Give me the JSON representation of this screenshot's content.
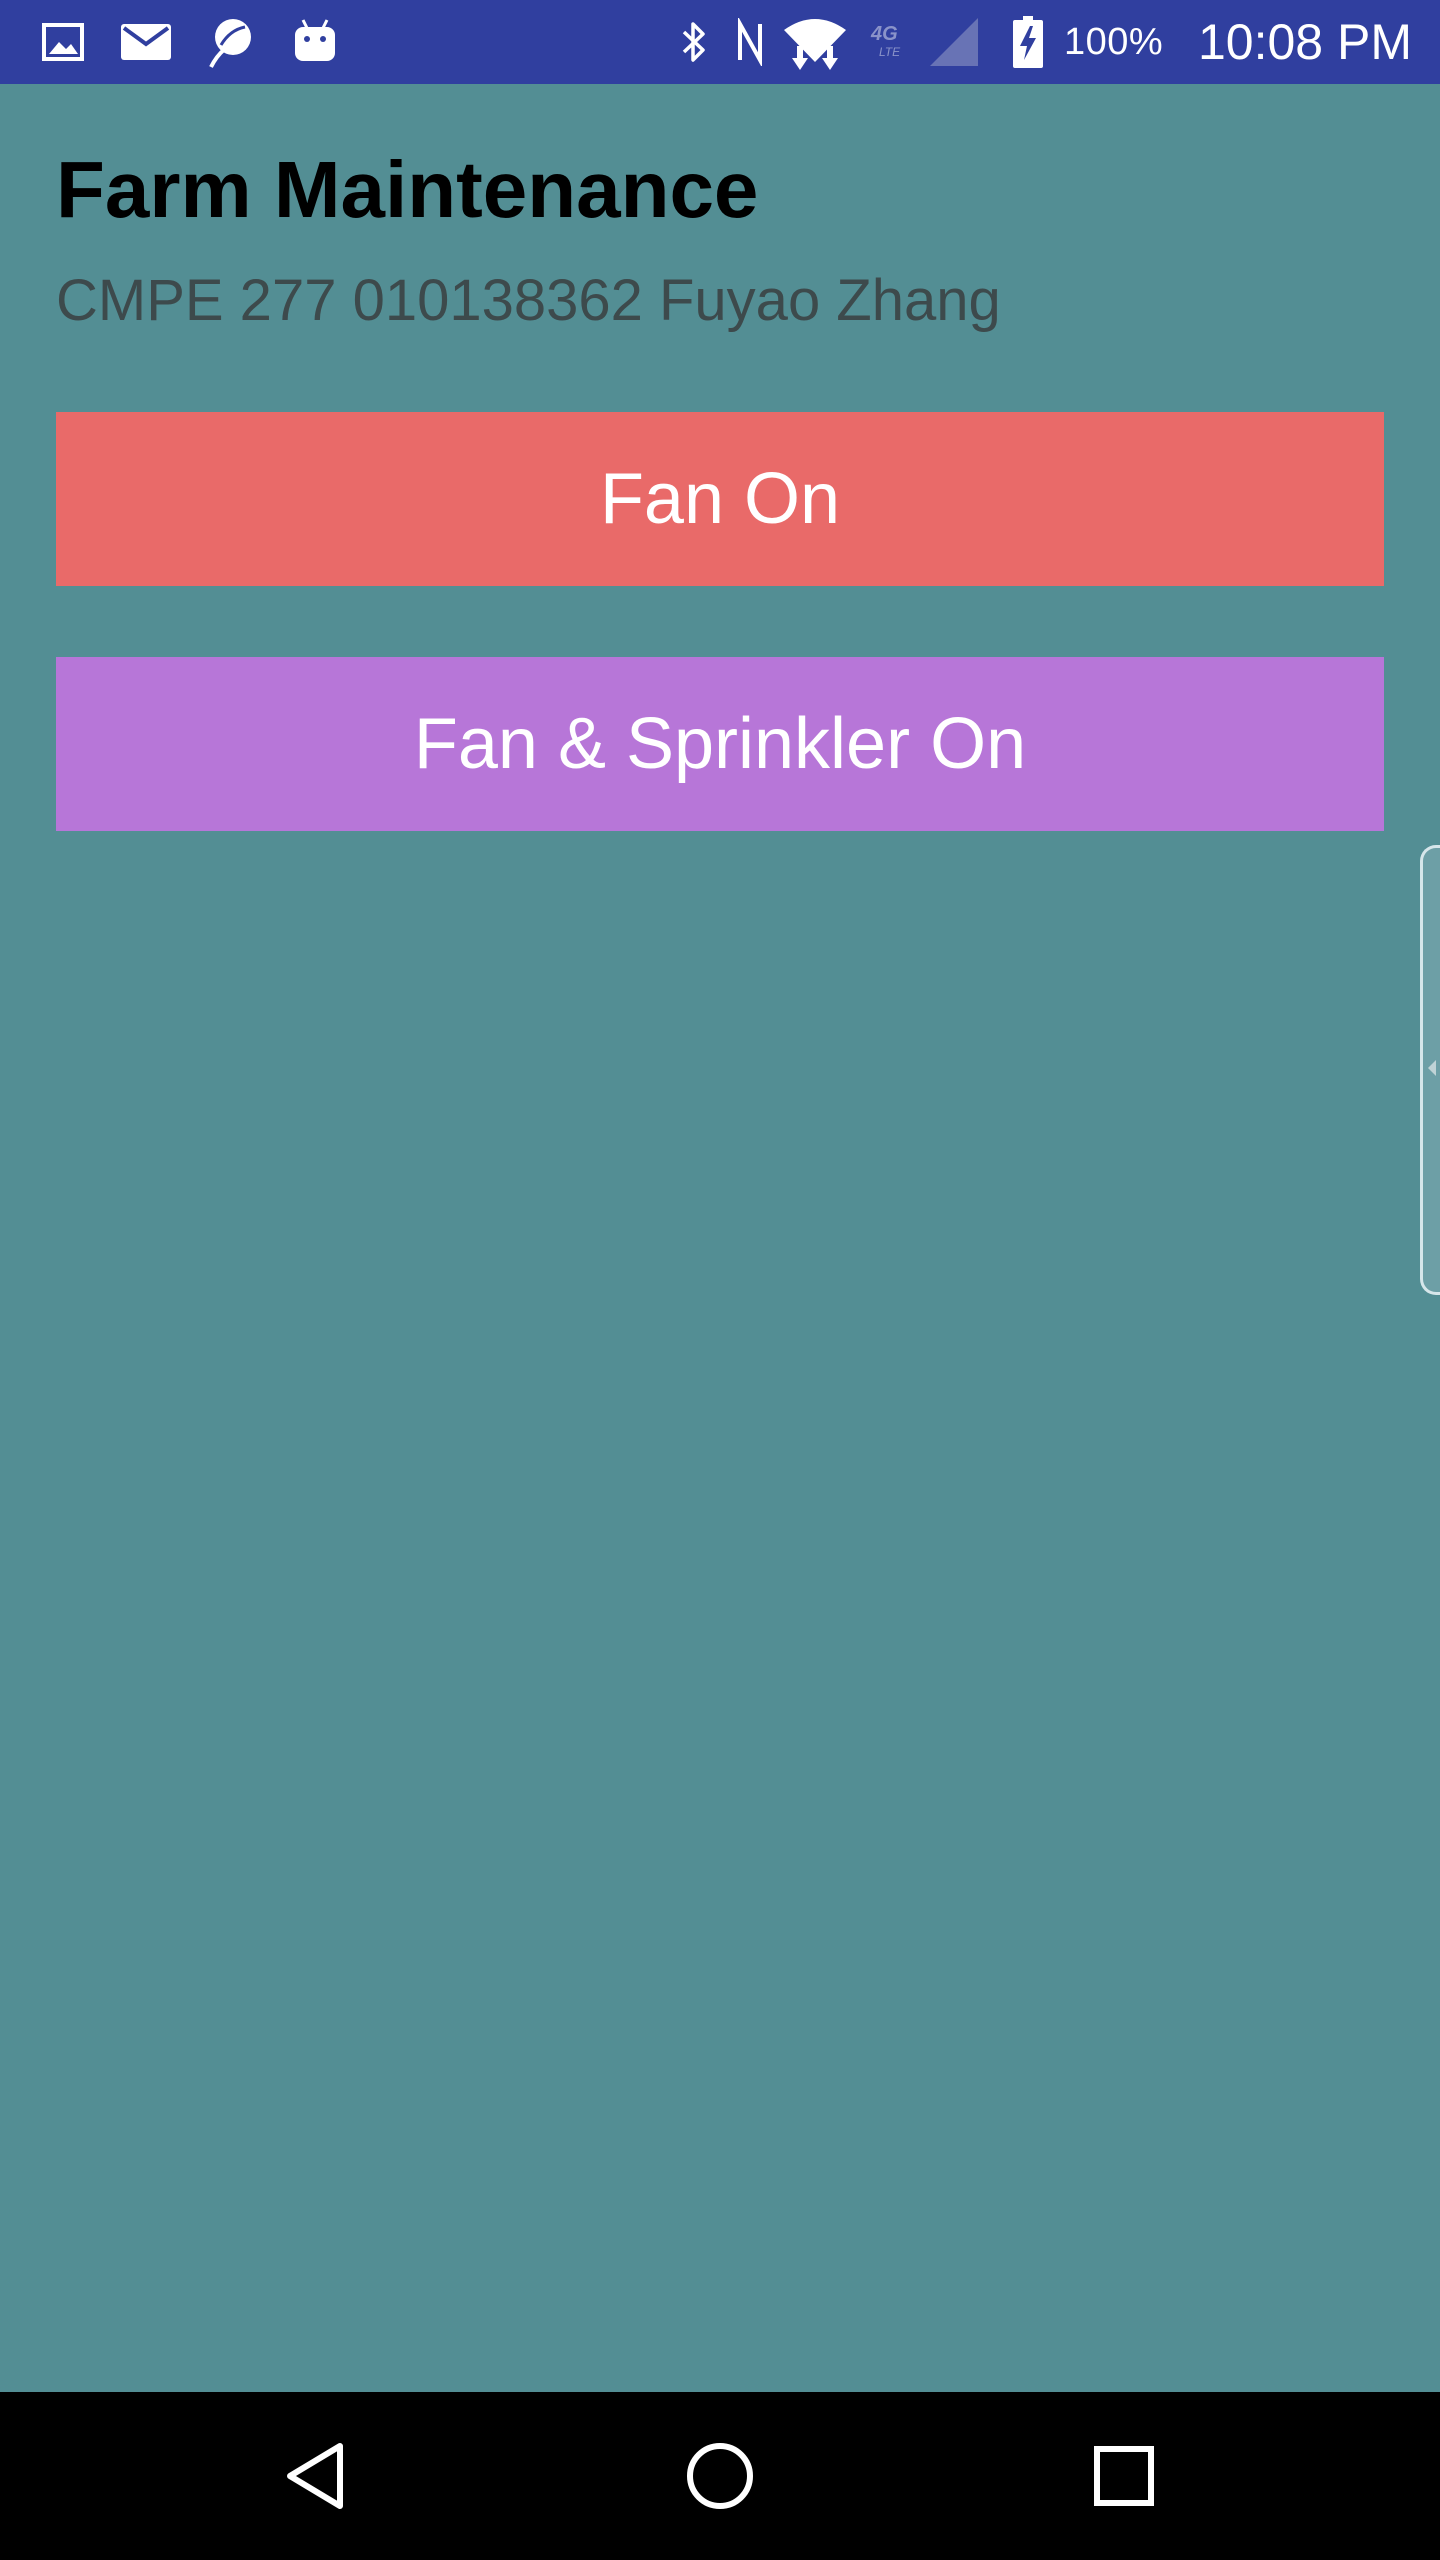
{
  "status_bar": {
    "left_icons": [
      "gallery-icon",
      "mail-icon",
      "sync-app-icon",
      "android-icon"
    ],
    "right_icons": [
      "bluetooth-icon",
      "nfc-icon",
      "wifi-icon",
      "lte-4g-icon",
      "signal-icon",
      "battery-charging-icon"
    ],
    "battery_percent": "100%",
    "time": "10:08 PM",
    "background_color": "#303f9f"
  },
  "app": {
    "title": "Farm Maintenance",
    "subtitle": "CMPE 277 010138362 Fuyao Zhang",
    "background_color": "#538e94"
  },
  "buttons": {
    "fan_on": {
      "label": "Fan On",
      "color": "#e96a69"
    },
    "fan_sprinkler_on": {
      "label": "Fan & Sprinkler On",
      "color": "#b776d8"
    }
  },
  "nav_bar": {
    "buttons": [
      "back-icon",
      "home-icon",
      "recents-icon"
    ]
  }
}
